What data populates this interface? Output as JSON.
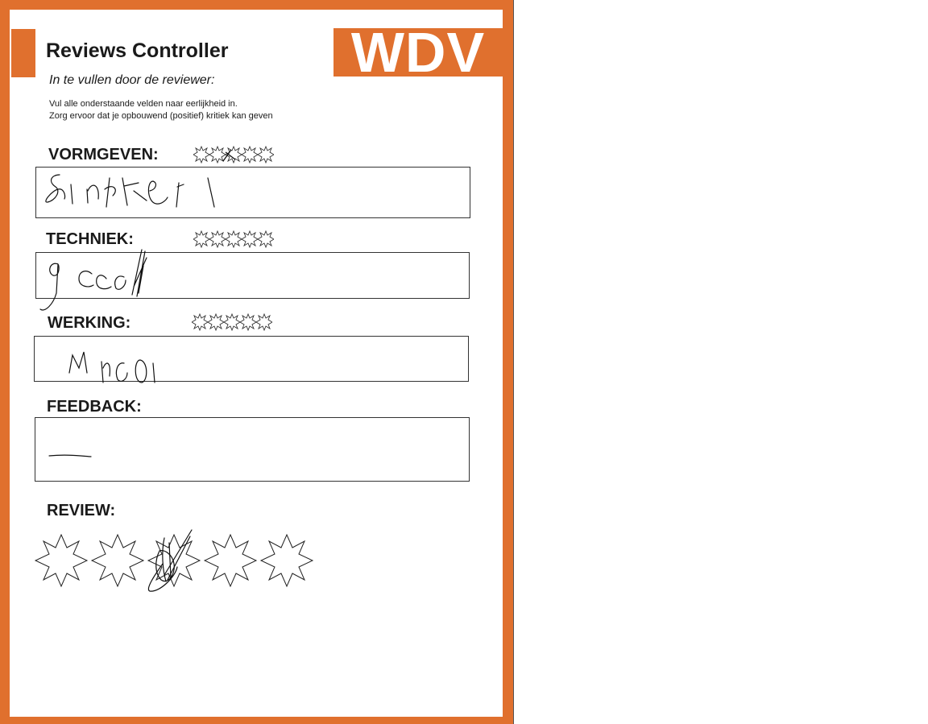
{
  "form": {
    "logo": "WDV",
    "title": "Reviews Controller",
    "subtitle": "In te vullen door de reviewer:",
    "instruction_line1": "Vul alle onderstaande velden naar eerlijkheid in.",
    "instruction_line2": "Zorg ervoor dat je opbouwend (positief) kritiek kan geven"
  },
  "sections": {
    "vormgeven": {
      "label": "VORMGEVEN:",
      "star_max": 5
    },
    "techniek": {
      "label": "TECHNIEK:",
      "star_max": 5
    },
    "werking": {
      "label": "WERKING:",
      "star_max": 5
    },
    "feedback": {
      "label": "FEEDBACK:"
    },
    "review": {
      "label": "REVIEW:",
      "star_max": 5,
      "marked_star": 3
    }
  },
  "colors": {
    "brand_orange": "#e0702e",
    "ink": "#1a1a1a"
  }
}
